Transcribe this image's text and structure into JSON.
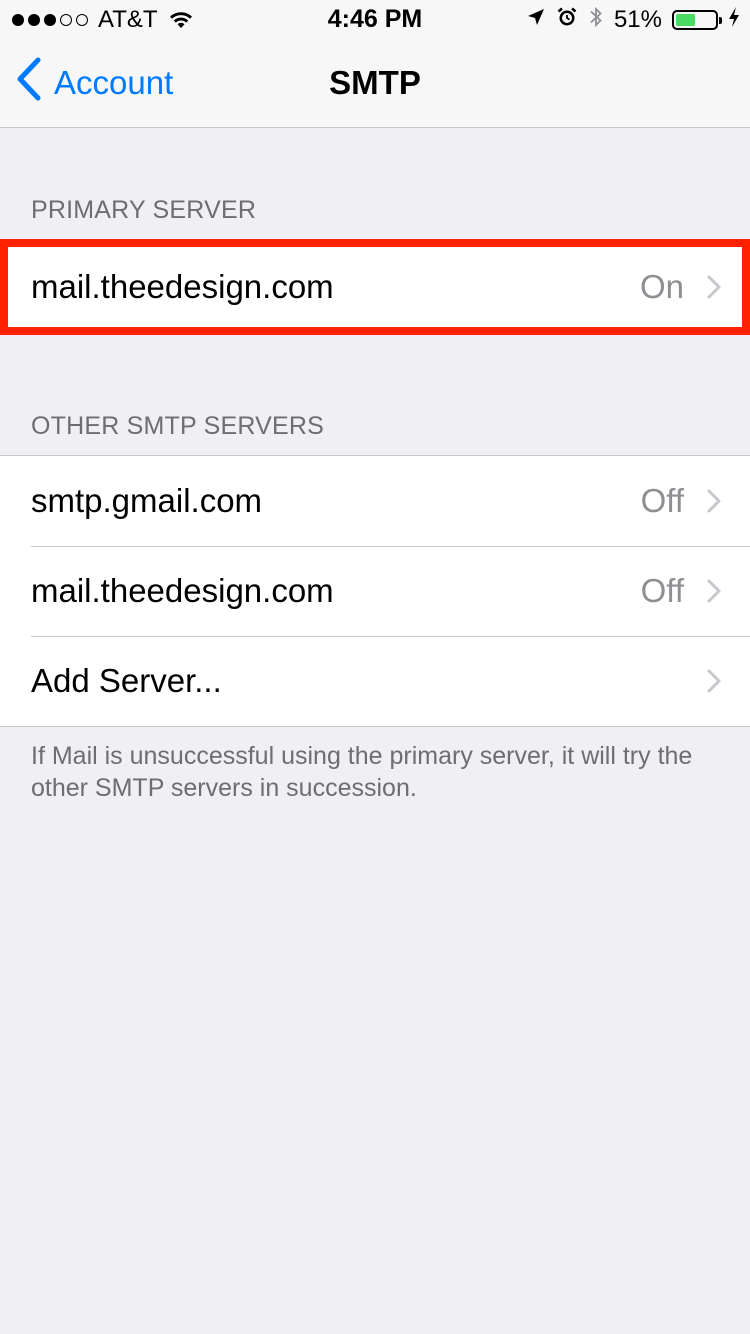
{
  "status_bar": {
    "carrier": "AT&T",
    "signal_dots_filled": 3,
    "signal_dots_total": 5,
    "time": "4:46 PM",
    "battery_percent": "51%",
    "battery_level": 0.51,
    "battery_fill_color": "#4cd964",
    "icons": [
      "location-arrow-icon",
      "alarm-clock-icon",
      "bluetooth-icon",
      "battery-icon",
      "charging-bolt-icon"
    ]
  },
  "nav": {
    "back_label": "Account",
    "title": "SMTP",
    "accent_color": "#007aff"
  },
  "primary_server": {
    "header": "PRIMARY SERVER",
    "host": "mail.theedesign.com",
    "status": "On",
    "highlight_color": "#ff2200"
  },
  "other_servers": {
    "header": "OTHER SMTP SERVERS",
    "items": [
      {
        "host": "smtp.gmail.com",
        "status": "Off"
      },
      {
        "host": "mail.theedesign.com",
        "status": "Off"
      }
    ],
    "add_label": "Add Server..."
  },
  "footer_note": "If Mail is unsuccessful using the primary server, it will try the other SMTP servers in succession."
}
